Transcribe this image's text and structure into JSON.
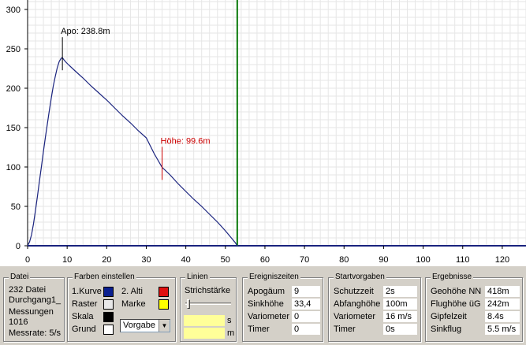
{
  "chart_data": {
    "type": "line",
    "xlim": [
      0,
      126
    ],
    "ylim": [
      0,
      310
    ],
    "x_ticks": [
      0,
      10,
      20,
      30,
      40,
      50,
      60,
      70,
      80,
      90,
      100,
      110,
      120
    ],
    "y_ticks": [
      0,
      50,
      100,
      150,
      200,
      250,
      300
    ],
    "grid": true,
    "series": [
      {
        "color": "#1a237e",
        "points": [
          [
            0.0,
            0
          ],
          [
            0.5,
            5
          ],
          [
            1.0,
            14
          ],
          [
            1.5,
            28
          ],
          [
            2.0,
            45
          ],
          [
            2.5,
            63
          ],
          [
            3.0,
            82
          ],
          [
            3.5,
            101
          ],
          [
            4.0,
            120
          ],
          [
            4.5,
            138
          ],
          [
            5.0,
            155
          ],
          [
            5.5,
            172
          ],
          [
            6.0,
            188
          ],
          [
            6.5,
            203
          ],
          [
            7.0,
            215
          ],
          [
            7.5,
            226
          ],
          [
            8.0,
            234
          ],
          [
            8.5,
            238
          ],
          [
            8.8,
            238.8
          ],
          [
            9.2,
            236
          ],
          [
            9.7,
            233
          ],
          [
            10.5,
            229
          ],
          [
            12.0,
            222
          ],
          [
            14.0,
            213
          ],
          [
            16.0,
            203
          ],
          [
            18.0,
            194
          ],
          [
            20.0,
            185
          ],
          [
            22.0,
            175
          ],
          [
            24.0,
            165
          ],
          [
            26.0,
            156
          ],
          [
            28.0,
            146
          ],
          [
            30.0,
            137
          ],
          [
            32.0,
            117
          ],
          [
            34.0,
            99.6
          ],
          [
            36.0,
            90
          ],
          [
            38.0,
            79
          ],
          [
            40.0,
            69
          ],
          [
            42.0,
            59
          ],
          [
            44.0,
            50
          ],
          [
            46.0,
            40
          ],
          [
            48.0,
            30
          ],
          [
            50.0,
            19
          ],
          [
            51.5,
            10
          ],
          [
            52.5,
            4
          ],
          [
            53.0,
            0
          ]
        ]
      }
    ],
    "annotations": [
      {
        "text": "Apo: 238.8m",
        "x": 8.8,
        "y": 238.8,
        "color": "#000000"
      },
      {
        "text": "Höhe: 99.6m",
        "x": 34.0,
        "y": 99.6,
        "color": "#cc0000"
      }
    ],
    "cursor_x": 53,
    "cursor_color": "#0b7a0b",
    "baseline_color": "#1a237e"
  },
  "panels": {
    "datei": {
      "title": "Datei",
      "file_line1": "232 Datei",
      "file_line2": "Durchgang1_",
      "messungen_label": "Messungen",
      "messungen_value": "1016",
      "messrate": "Messrate: 5/s"
    },
    "farben": {
      "title": "Farben einstellen",
      "kurve_label": "1.Kurve",
      "kurve_color": "#0a1f8f",
      "alti_label": "2. Alti",
      "alti_color": "#e01010",
      "raster_label": "Raster",
      "raster_color": "#e8e8e8",
      "marke_label": "Marke",
      "marke_color": "#ffff00",
      "skala_label": "Skala",
      "skala_color": "#000000",
      "grund_label": "Grund",
      "grund_color": "#ffffff",
      "vorgabe": "Vorgabe"
    },
    "linien": {
      "title": "Linien",
      "strichstaerke": "Strichstärke",
      "unit_s": "s",
      "unit_m": "m"
    },
    "ereigniszeiten": {
      "title": "Ereigniszeiten",
      "rows": [
        {
          "label": "Apogäum",
          "value": "9"
        },
        {
          "label": "Sinkhöhe",
          "value": "33,4"
        },
        {
          "label": "Variometer",
          "value": "0"
        },
        {
          "label": "Timer",
          "value": "0"
        }
      ]
    },
    "startvorgaben": {
      "title": "Startvorgaben",
      "rows": [
        {
          "label": "Schutzzeit",
          "value": "2s"
        },
        {
          "label": "Abfanghöhe",
          "value": "100m"
        },
        {
          "label": "Variometer",
          "value": "16 m/s"
        },
        {
          "label": "Timer",
          "value": "0s"
        }
      ]
    },
    "ergebnisse": {
      "title": "Ergebnisse",
      "rows": [
        {
          "label": "Geohöhe NN",
          "value": "418m"
        },
        {
          "label": "Flughöhe üG",
          "value": "242m"
        },
        {
          "label": "Gipfelzeit",
          "value": "8.4s"
        },
        {
          "label": "Sinkflug",
          "value": "5.5 m/s"
        }
      ]
    }
  }
}
